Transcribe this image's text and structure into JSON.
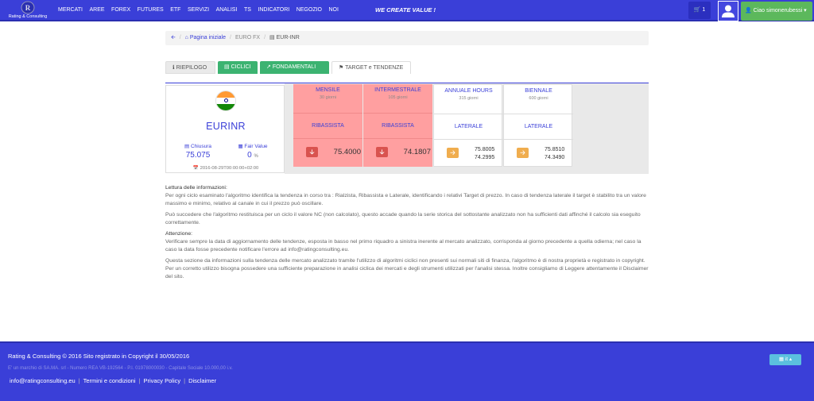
{
  "brand": {
    "name": "Rating & Consulting"
  },
  "nav": {
    "items": [
      "MERCATI",
      "AREE",
      "FOREX",
      "FUTURES",
      "ETF",
      "SERVIZI",
      "ANALISI",
      "TS",
      "INDICATORI",
      "NEGOZIO",
      "NOI"
    ],
    "slogan": "WE CREATE VALUE !",
    "cart_count": "1",
    "user_greeting": "Ciao",
    "user_name": "simonerubessi"
  },
  "breadcrumb": {
    "home": "Pagina iniziale",
    "section": "EURO FX",
    "current": "EUR-INR"
  },
  "tabs": {
    "riepilogo": "RIEPILOGO",
    "ciclici": "CICLICI",
    "fondamentali": "FONDAMENTALI",
    "target": "TARGET e TENDENZE"
  },
  "instrument": {
    "symbol": "EURINR",
    "close_label": "Chiusura",
    "close_value": "75.075",
    "fair_label": "Fair Value",
    "fair_value": "0",
    "fair_unit": "%",
    "date": "2016-08-29T00:00:00+02:00"
  },
  "cycles": [
    {
      "title": "MENSILE",
      "sub": "30 giorni",
      "trend": "RIBASSISTA",
      "direction": "down",
      "target": "75.4000",
      "target_high": "",
      "target_low": ""
    },
    {
      "title": "INTERMESTRALE",
      "sub": "105 giorni",
      "trend": "RIBASSISTA",
      "direction": "down",
      "target": "74.1807",
      "target_high": "",
      "target_low": ""
    },
    {
      "title": "ANNUALE HOURS",
      "sub": "315 giorni",
      "trend": "LATERALE",
      "direction": "lateral",
      "target": "",
      "target_high": "75.8005",
      "target_low": "74.2995"
    },
    {
      "title": "BIENNALE",
      "sub": "600 giorni",
      "trend": "LATERALE",
      "direction": "lateral",
      "target": "",
      "target_high": "75.8510",
      "target_low": "74.3490"
    }
  ],
  "info": {
    "heading1": "Lettura delle informazioni:",
    "p1": "Per ogni ciclo esaminato l'algoritmo identifica la tendenza in corso tra : Rialzista, Ribassista e Laterale, identificando i relativi Target di prezzo. In caso di tendenza laterale il target è stabilito tra un valore massimo e minimo, relativo al canale in cui il prezzo può oscillare.",
    "p2": "Può succedere che l'algoritmo restituisca per un ciclo il valore NC (non calcolato), questo accade quando la serie storica del sottostante analizzato non ha sufficienti dati affinché il calcolo sia eseguito correttamente.",
    "heading2": "Attenzione:",
    "p3": "Verificare sempre la data di aggiornamento delle tendenze, esposta in basso nel primo riquadro a sinistra inerente al mercato analizzato, corrisponda al giorno precedente a quella odierna; nel caso la caso la data fosse precedente notificare l'errore ad info@ratingconsulting.eu.",
    "p4": "Questa sezione da informazioni sulla tendenza delle mercato analizzato tramite l'utilizzo di algoritmi ciclici non presenti sui normali siti di finanza, l'algoritmo è di nostra proprietà e registrato in copyright. Per un corretto utilizzo bisogna possedere una sufficiente preparazione in analisi ciclica dei mercati e degli strumenti utilizzati per l'analisi stessa. Inoltre consigliamo di Leggere attentamente il Disclaimer del sito."
  },
  "footer": {
    "line1": "Rating & Consulting © 2016 Sito registrato in Copyright il 30/05/2016",
    "line2": "E' un marchio di SA.MA. srl - Numero REA VB-192564 - P.I. 01978000030 - Capitale Sociale 10.000,00 i.v.",
    "email": "info@ratingconsulting.eu",
    "terms": "Termini e condizioni",
    "privacy": "Privacy Policy",
    "disclaimer": "Disclaimer",
    "lang": "it"
  },
  "colors": {
    "primary": "#3a3fd8",
    "green": "#3cb371",
    "bearish_bg": "#ff9fa0",
    "arrow_down": "#d9534f",
    "arrow_lateral": "#f0ad4e"
  }
}
